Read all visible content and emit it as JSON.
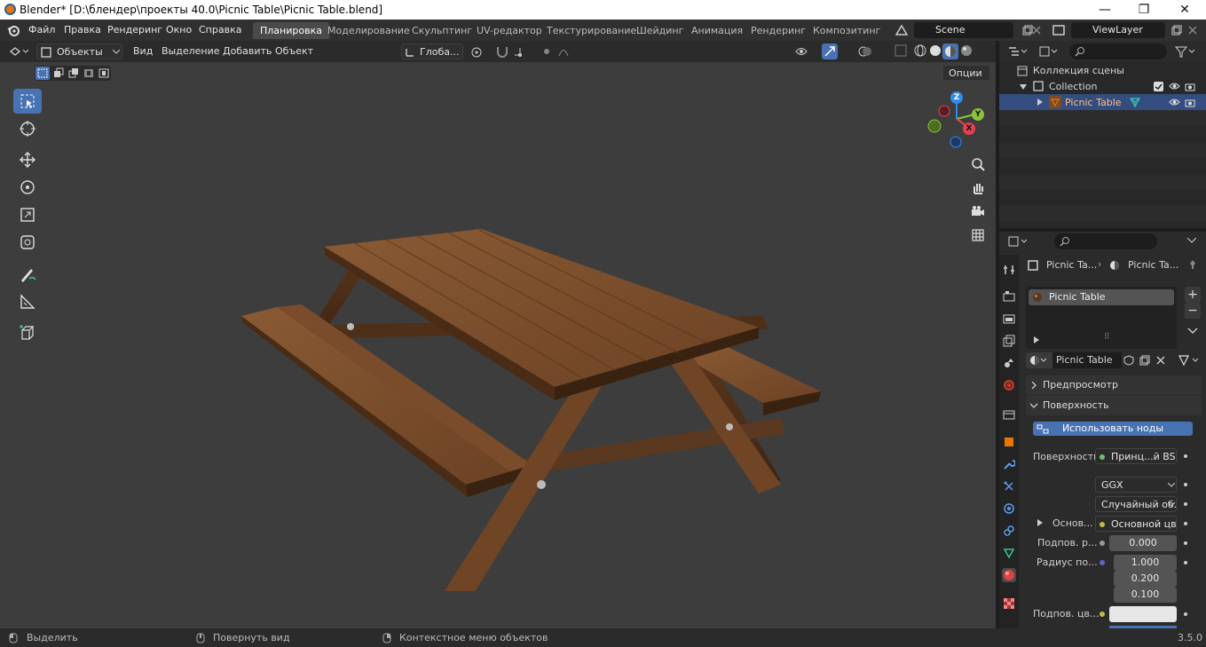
{
  "window": {
    "title": "Blender* [D:\\блендер\\проекты 40.0\\Picnic Table\\Picnic Table.blend]",
    "minimize": "—",
    "maximize": "❐",
    "close": "✕"
  },
  "menubar": [
    "Файл",
    "Правка",
    "Рендеринг",
    "Окно",
    "Справка"
  ],
  "workspaces": [
    "Планировка",
    "Моделирование",
    "Скульптинг",
    "UV-редактор",
    "Текстурирование",
    "Шейдинг",
    "Анимация",
    "Рендеринг",
    "Композитинг"
  ],
  "active_workspace": 0,
  "scene_name": "Scene",
  "view_layer": "ViewLayer",
  "viewport": {
    "mode": "Объекты",
    "menus": [
      "Вид",
      "Выделение",
      "Добавить",
      "Объект"
    ],
    "transform_orientation": "Глоба...",
    "options_button": "Опции",
    "gizmo_axes": {
      "z": "Z",
      "y": "Y",
      "x": "X"
    }
  },
  "outliner": {
    "scene_collection": "Коллекция сцены",
    "collection": "Collection",
    "object": "Picnic Table"
  },
  "properties": {
    "breadcrumb_object": "Picnic Ta...",
    "breadcrumb_material": "Picnic Ta...",
    "material_slot": "Picnic Table",
    "material_name": "Picnic Table",
    "panel_preview": "Предпросмотр",
    "panel_surface": "Поверхность",
    "use_nodes_button": "Использовать ноды",
    "surface_label": "Поверхность",
    "surface_value": "Принц...й BSDF",
    "distribution": "GGX",
    "subsurface_method": "Случайный об...",
    "base_label": "Основ...",
    "base_value": "Основной цвет",
    "subsurface_label": "Подпов. р...",
    "subsurface_value": "0.000",
    "radius_label": "Радиус по...",
    "radius_values": [
      "1.000",
      "0.200",
      "0.100"
    ],
    "subsurface_color_label": "Подпов. цв..."
  },
  "status": {
    "select": "Выделить",
    "rotate": "Повернуть вид",
    "context": "Контекстное меню объектов",
    "version": "3.5.0"
  },
  "colors": {
    "accent": "#4772b3",
    "orange": "#ea7600",
    "axis_x": "#e6414f",
    "axis_y": "#8ac43a",
    "axis_z": "#2d8cf0"
  }
}
